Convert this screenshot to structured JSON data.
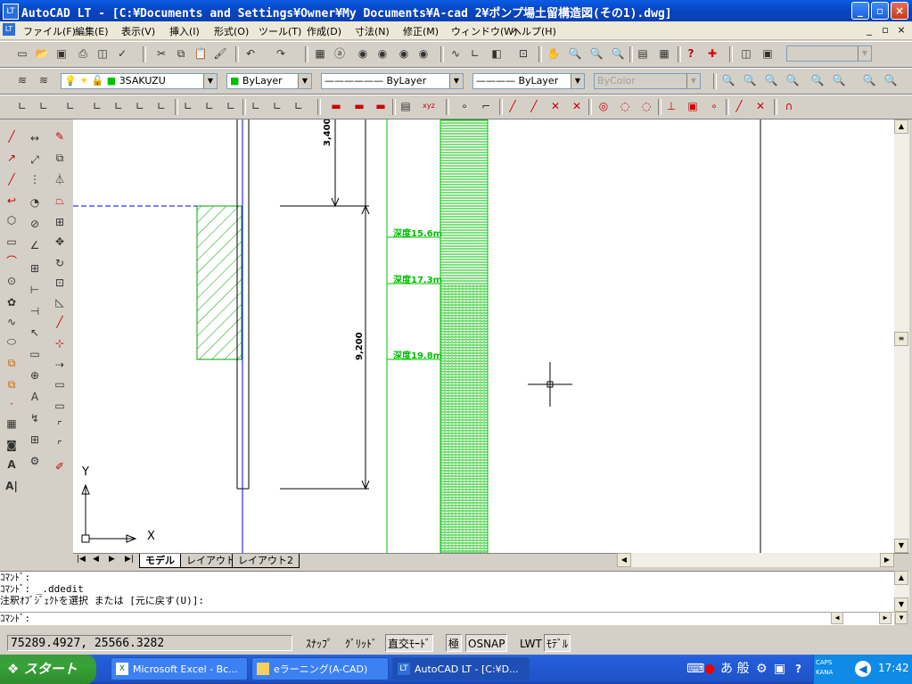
{
  "window": {
    "title": "AutoCAD LT - [C:¥Documents and Settings¥Owner¥My Documents¥A-cad 2¥ポンプ場土留構造図(その1).dwg]",
    "app_icon": "LT",
    "minimize_icon": "minimize-icon",
    "maximize_icon": "maximize-icon",
    "close_icon": "close-icon"
  },
  "menu": {
    "items": [
      "ファイル(F)",
      "編集(E)",
      "表示(V)",
      "挿入(I)",
      "形式(O)",
      "ツール(T)",
      "作成(D)",
      "寸法(N)",
      "修正(M)",
      "ウィンドウ(W)",
      "ヘルプ(H)"
    ],
    "mdi_controls": [
      "_",
      "▫",
      "×"
    ]
  },
  "properties_toolbar": {
    "layer": "3SAKUZU",
    "color": "ByLayer",
    "linetype": "ByLayer",
    "lineweight": "ByLayer",
    "plotstyle": "ByColor"
  },
  "drawing": {
    "dim_top": "3,400",
    "dim_main": "9,200",
    "depth_labels": [
      "深度15.6m",
      "深度17.3m",
      "深度19.8m"
    ],
    "ucs_x": "X",
    "ucs_y": "Y",
    "colors": {
      "green": "#00c000",
      "blue": "#0000ff",
      "line": "#000000"
    }
  },
  "layout_tabs": [
    "モデル",
    "レイアウト1",
    "レイアウト2"
  ],
  "command_history": [
    "ｺﾏﾝﾄﾞ:",
    "ｺﾏﾝﾄﾞ:  _.ddedit",
    "注釈ｵﾌﾞｼﾞｪｸﾄを選択 または [元に戻す(U)]:"
  ],
  "command_prompt": "ｺﾏﾝﾄﾞ:",
  "status": {
    "coords": "75289.4927, 25566.3282",
    "buttons": [
      "ｽﾅｯﾌﾟ",
      "ｸﾞﾘｯﾄﾞ",
      "直交ﾓｰﾄﾞ",
      "極",
      "OSNAP",
      "LWT",
      "ﾓﾃﾞﾙ"
    ]
  },
  "taskbar": {
    "start": "スタート",
    "tasks": [
      "Microsoft Excel - Bc...",
      "eラーニング(A-CAD)",
      "AutoCAD LT - [C:¥D..."
    ],
    "ime_label": "あ 般",
    "caps": "CAPS",
    "kana": "KANA",
    "clock": "17:42"
  }
}
